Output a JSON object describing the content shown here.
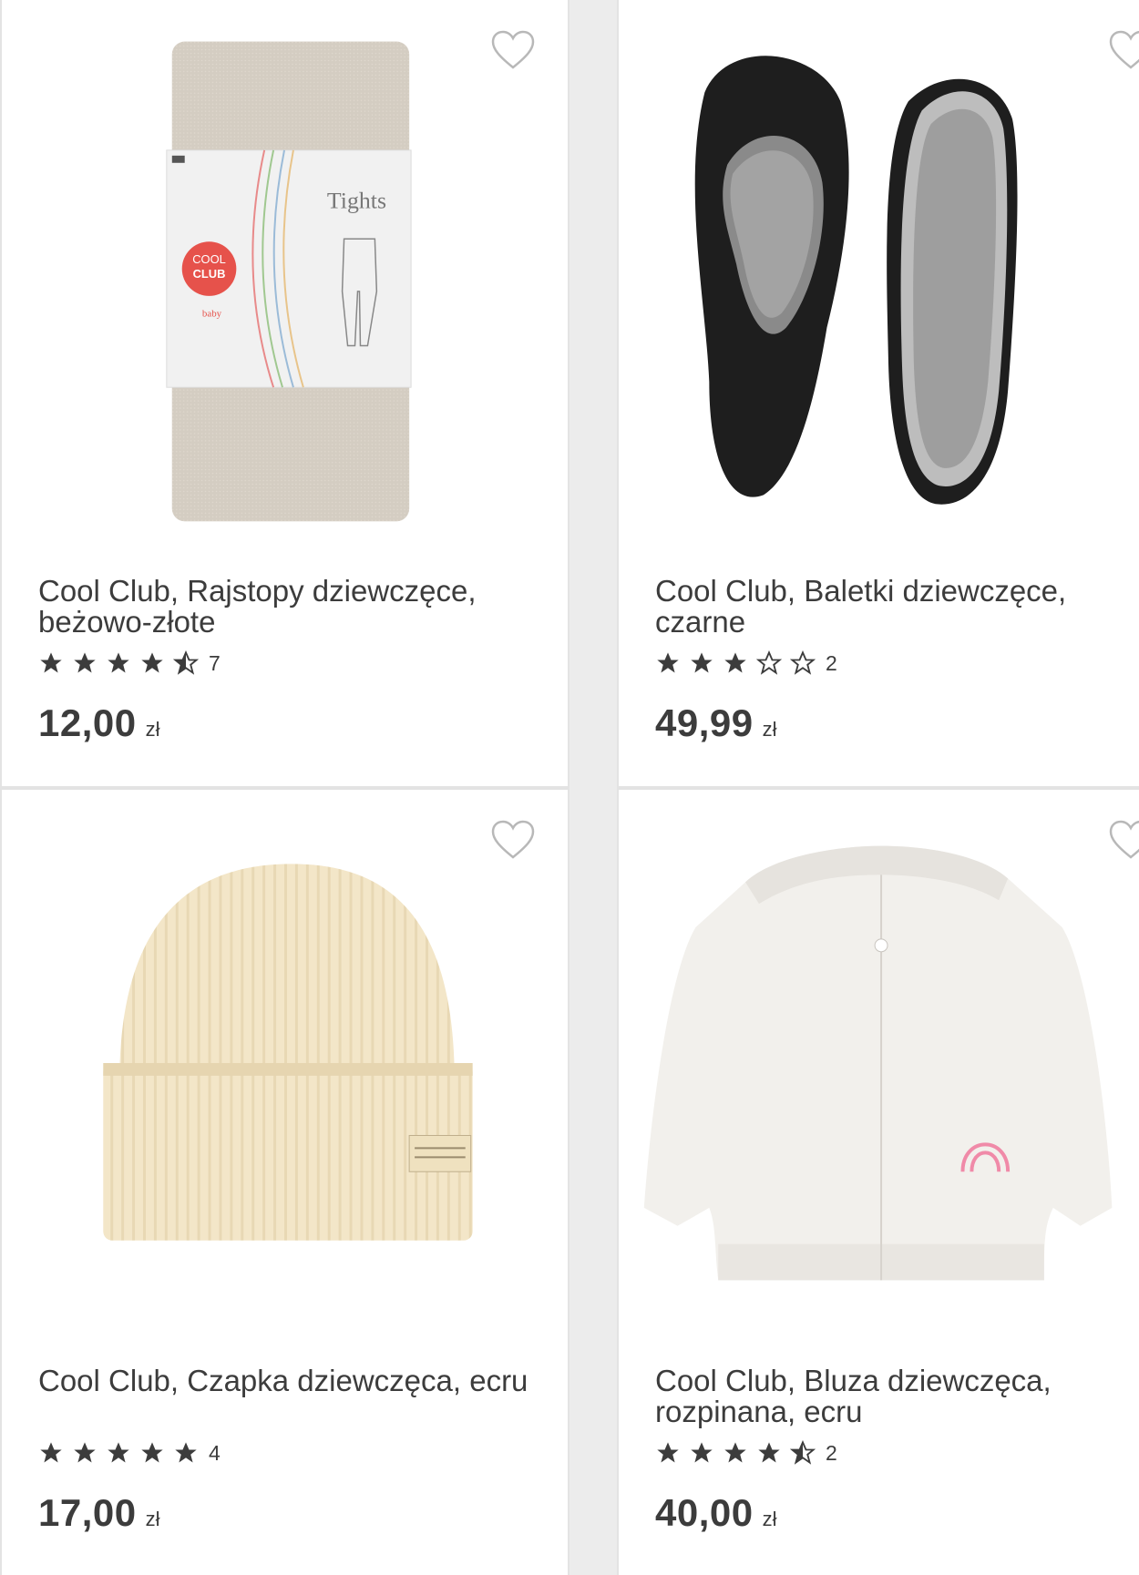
{
  "products": [
    {
      "name": "Cool Club, Rajstopy dziewczęce, beżowo-złote",
      "rating": 4.5,
      "reviews": "7",
      "price": "12,00",
      "currency": "zł",
      "packaging": {
        "brand_top": "COOL",
        "brand_bottom": "CLUB",
        "label": "Tights",
        "sub": "baby"
      }
    },
    {
      "name": "Cool Club, Baletki dziewczęce, czarne",
      "rating": 3,
      "reviews": "2",
      "price": "49,99",
      "currency": "zł"
    },
    {
      "name": "Cool Club, Czapka dziewczęca, ecru",
      "rating": 5,
      "reviews": "4",
      "price": "17,00",
      "currency": "zł"
    },
    {
      "name": "Cool Club, Bluza dziewczęca, rozpinana, ecru",
      "rating": 4.5,
      "reviews": "2",
      "price": "40,00",
      "currency": "zł"
    }
  ],
  "colors": {
    "text": "#3c3c3c",
    "star": "#3c3c3c",
    "heart": "#b8b8b8",
    "border": "#e3e3e3"
  }
}
